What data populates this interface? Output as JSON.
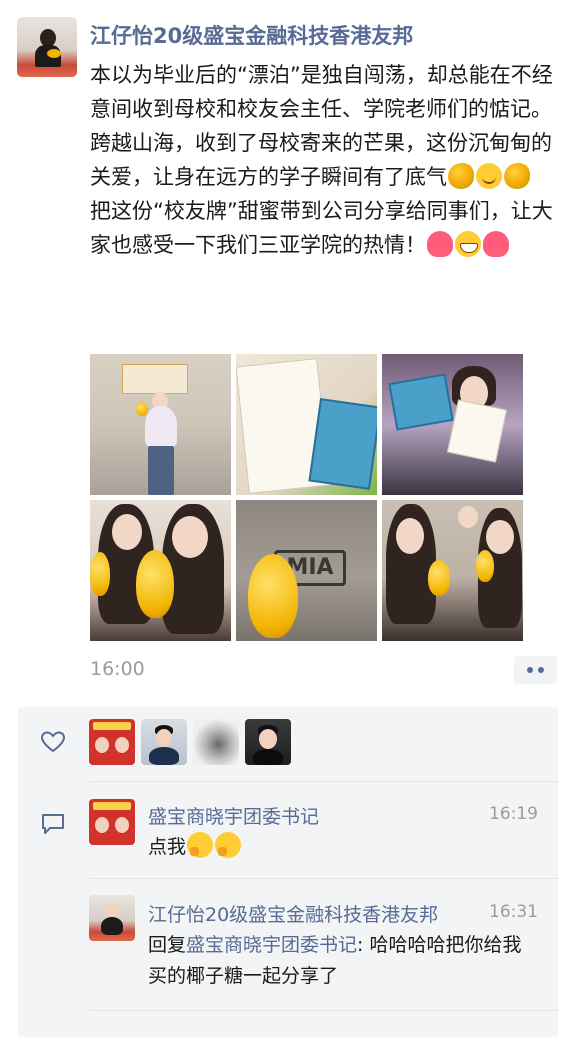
{
  "post": {
    "author": "江仔怡20级盛宝金融科技香港友邦",
    "paragraph1": "本以为毕业后的“漂泊”是独自闯荡，却总能在不经意间收到母校和校友会主任、学院老师们的惦记。跨越山海，收到了母校寄来的芒果，这份沉甸甸的关爱，让身在远方的学子瞬间有了底气",
    "paragraph2": "把这份“校友牌”甜蜜带到公司分享给同事们，让大家也感受一下我们三亚学院的热情！",
    "time": "16:00",
    "photo_logo_text": "MIA"
  },
  "interactions": {
    "likes": [
      "avatar-1",
      "avatar-2",
      "avatar-3",
      "avatar-4"
    ],
    "comments": [
      {
        "author": "盛宝商晓宇团委书记",
        "time": "16:19",
        "text": "点我"
      },
      {
        "author": "江仔怡20级盛宝金融科技香港友邦",
        "time": "16:31",
        "reply_prefix": "回复",
        "reply_to": "盛宝商晓宇团委书记",
        "text": ": 哈哈哈哈把你给我买的椰子糖一起分享了"
      }
    ]
  },
  "icons": {
    "like": "heart-outline-icon",
    "comment": "comment-bubble-icon",
    "more": "more-dots-icon"
  },
  "colors": {
    "name_blue": "#576b95",
    "panel_bg": "#f3f4f6",
    "meta_gray": "#9b9b9b"
  }
}
